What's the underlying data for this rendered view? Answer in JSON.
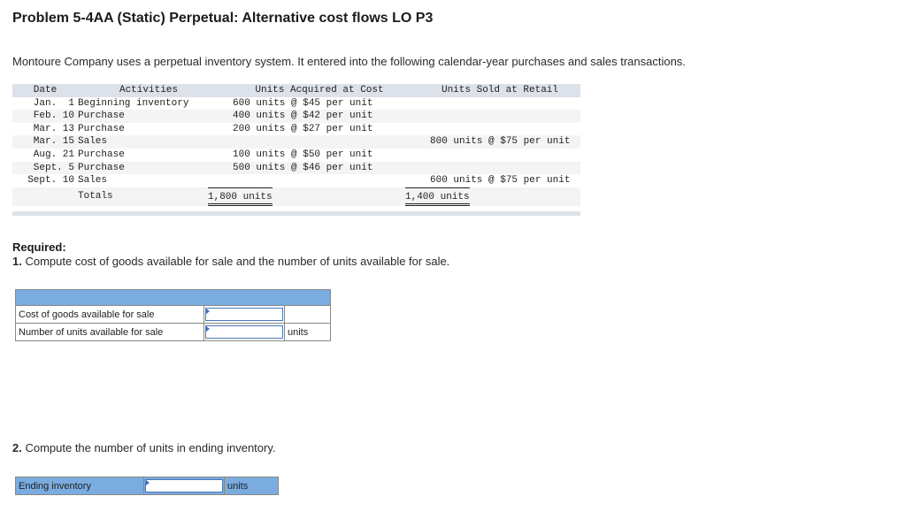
{
  "problem": {
    "title": "Problem 5-4AA (Static) Perpetual: Alternative cost flows LO P3",
    "intro": "Montoure Company uses a perpetual inventory system. It entered into the following calendar-year purchases and sales transactions."
  },
  "inventory_table": {
    "headers": {
      "date": "Date",
      "activities": "Activities",
      "acquired": "Units Acquired at Cost",
      "sold": "Units Sold at Retail"
    },
    "rows": [
      {
        "date": "Jan.  1",
        "activity": "Beginning inventory",
        "acquired": "600 units @ $45 per unit",
        "sold": ""
      },
      {
        "date": "Feb. 10",
        "activity": "Purchase",
        "acquired": "400 units @ $42 per unit",
        "sold": ""
      },
      {
        "date": "Mar. 13",
        "activity": "Purchase",
        "acquired": "200 units @ $27 per unit",
        "sold": ""
      },
      {
        "date": "Mar. 15",
        "activity": "Sales",
        "acquired": "",
        "sold": "800 units @ $75 per unit"
      },
      {
        "date": "Aug. 21",
        "activity": "Purchase",
        "acquired": "100 units @ $50 per unit",
        "sold": ""
      },
      {
        "date": "Sept. 5",
        "activity": "Purchase",
        "acquired": "500 units @ $46 per unit",
        "sold": ""
      },
      {
        "date": "Sept. 10",
        "activity": "Sales",
        "acquired": "",
        "sold": "600 units @ $75 per unit"
      }
    ],
    "totals": {
      "label": "Totals",
      "acquired": "1,800 units",
      "sold": "1,400 units"
    }
  },
  "required": {
    "label": "Required:",
    "q1_num": "1.",
    "q1_text": " Compute cost of goods available for sale and the number of units available for sale.",
    "q1_rows": [
      {
        "label": "Cost of goods available for sale",
        "value": "",
        "unit": ""
      },
      {
        "label": "Number of units available for sale",
        "value": "",
        "unit": "units"
      }
    ],
    "q2_num": "2.",
    "q2_text": " Compute the number of units in ending inventory.",
    "q2_row": {
      "label": "Ending inventory",
      "value": "",
      "unit": "units"
    }
  },
  "colors": {
    "header_blue": "#7aace0",
    "table_header_gray": "#dde1ea",
    "input_border": "#4a7ab8"
  }
}
